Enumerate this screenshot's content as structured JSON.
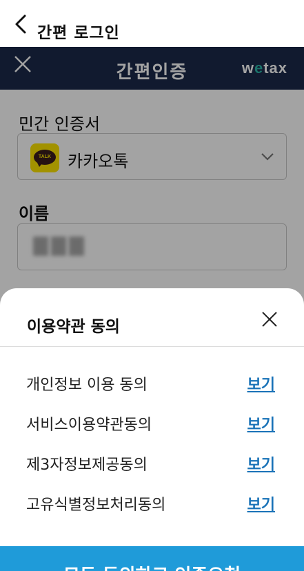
{
  "app_header": {
    "title": "간편 로그인"
  },
  "web_header": {
    "title": "간편인증",
    "logo_prefix": "w",
    "logo_o": "e",
    "logo_suffix": "tax"
  },
  "form": {
    "cert_label": "민간 인증서",
    "cert_selected": "카카오톡",
    "cert_icon_text": "TALK",
    "name_label": "이름"
  },
  "sheet": {
    "title": "이용약관 동의",
    "terms": [
      {
        "label": "개인정보 이용 동의",
        "link": "보기"
      },
      {
        "label": "서비스이용약관동의",
        "link": "보기"
      },
      {
        "label": "제3자정보제공동의",
        "link": "보기"
      },
      {
        "label": "고유식별정보처리동의",
        "link": "보기"
      }
    ],
    "confirm_label": "모두 동의하고 인증요청"
  },
  "colors": {
    "navy": "#1b2a4a",
    "kakao": "#fee500",
    "link": "#1a73b8",
    "button": "#1f9bd9"
  },
  "icons": {
    "back": "chevron-left-icon",
    "web_close": "close-icon",
    "dropdown": "chevron-down-icon",
    "sheet_close": "close-icon"
  }
}
